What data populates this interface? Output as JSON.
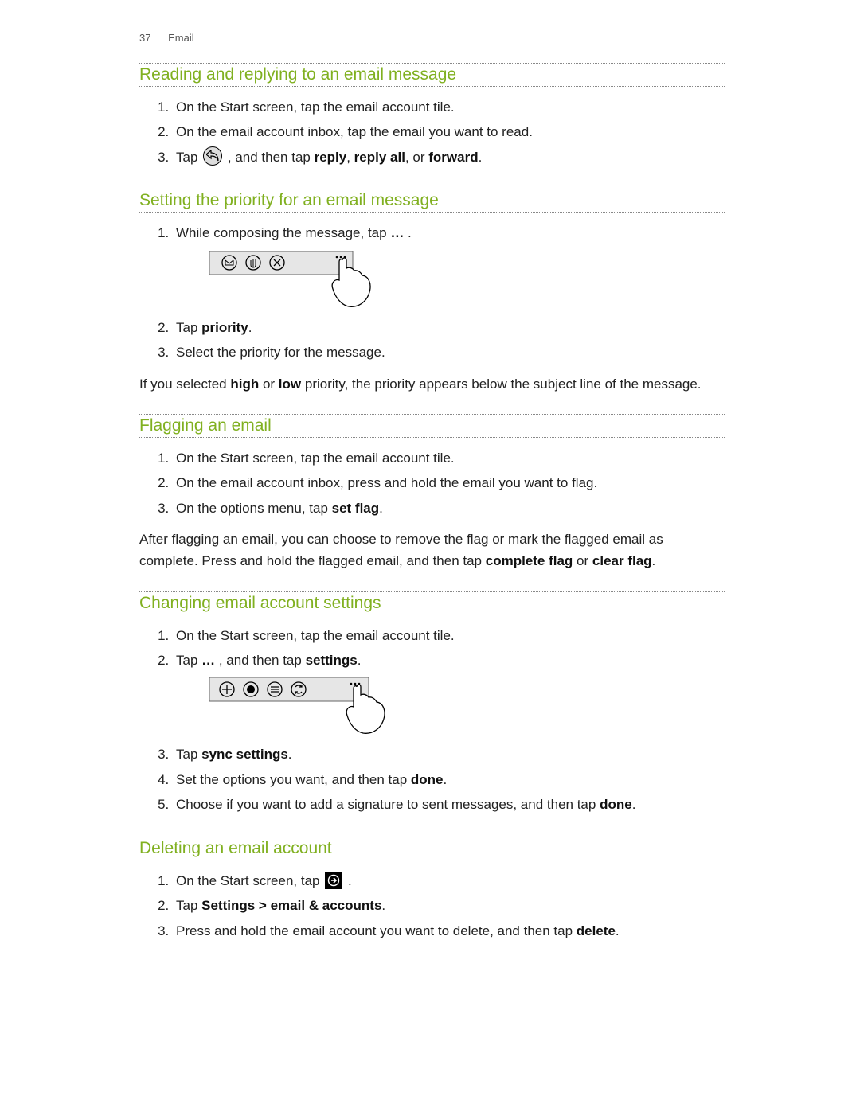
{
  "header": {
    "page_number": "37",
    "section": "Email"
  },
  "sections": {
    "reading": {
      "title": "Reading and replying to an email message",
      "step1": "On the Start screen, tap the email account tile.",
      "step2": "On the email account inbox, tap the email you want to read.",
      "step3_a": "Tap ",
      "step3_b": ", and then tap ",
      "reply": "reply",
      "comma1": ", ",
      "reply_all": "reply all",
      "comma_or": ", or ",
      "forward": "forward",
      "period": "."
    },
    "priority": {
      "title": "Setting the priority for an email message",
      "step1_a": "While composing the message, tap ",
      "ellipsis": "…",
      "step1_c": " .",
      "step2_a": "Tap ",
      "priority_word": "priority",
      "step2_c": ".",
      "step3": "Select the priority for the message.",
      "note_a": "If you selected ",
      "high": "high",
      "note_b": " or ",
      "low": "low",
      "note_c": " priority, the priority appears below the subject line of the message."
    },
    "flagging": {
      "title": "Flagging an email",
      "step1": "On the Start screen, tap the email account tile.",
      "step2": "On the email account inbox, press and hold the email you want to flag.",
      "step3_a": "On the options menu, tap ",
      "set_flag": "set flag",
      "step3_c": ".",
      "note_a": "After flagging an email, you can choose to remove the flag or mark the flagged email as complete. Press and hold the flagged email, and then tap ",
      "complete_flag": "complete flag",
      "note_b": " or ",
      "clear_flag": "clear flag",
      "note_c": "."
    },
    "changing": {
      "title": "Changing email account settings",
      "step1": "On the Start screen, tap the email account tile.",
      "step2_a": "Tap ",
      "ellipsis": "…",
      "step2_b": " , and then tap ",
      "settings": "settings",
      "step2_c": ".",
      "step3_a": "Tap ",
      "sync_settings": "sync settings",
      "step3_c": ".",
      "step4_a": "Set the options you want, and then tap ",
      "done": "done",
      "step4_c": ".",
      "step5_a": "Choose if you want to add a signature to sent messages, and then tap ",
      "done2": "done",
      "step5_c": "."
    },
    "deleting": {
      "title": "Deleting an email account",
      "step1_a": "On the Start screen, tap ",
      "step1_c": " .",
      "step2_a": "Tap ",
      "settings_path": "Settings > email & accounts",
      "step2_c": ".",
      "step3_a": "Press and hold the email account you want to delete, and then tap ",
      "delete": "delete",
      "step3_c": "."
    }
  }
}
